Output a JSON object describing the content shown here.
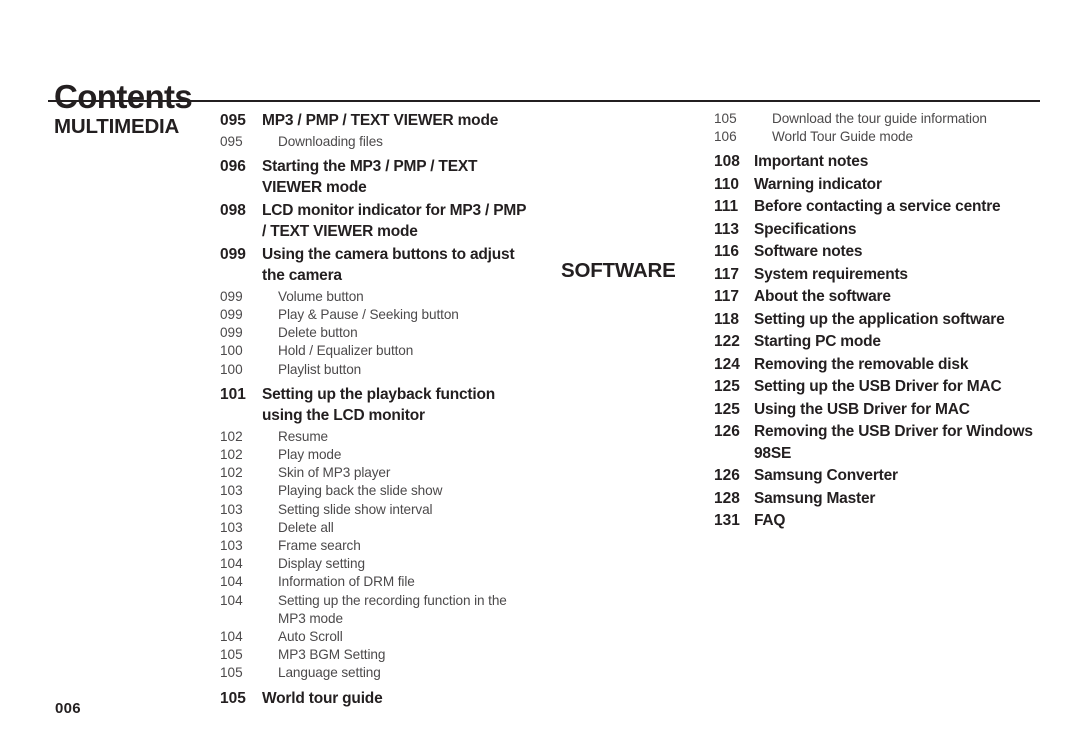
{
  "header": {
    "title": "Contents"
  },
  "footer": {
    "folio": "006"
  },
  "sections": {
    "multimedia_label": "MULTIMEDIA",
    "software_label": "SOFTWARE"
  },
  "columns": {
    "left": [
      {
        "num": "095",
        "title": "MP3 / PMP / TEXT VIEWER mode",
        "level": "major"
      },
      {
        "num": "095",
        "title": "Downloading files",
        "level": "minor"
      },
      {
        "num": "096",
        "title": "Starting the MP3 / PMP / TEXT VIEWER mode",
        "level": "major"
      },
      {
        "num": "098",
        "title": "LCD monitor indicator for MP3 / PMP / TEXT VIEWER mode",
        "level": "major"
      },
      {
        "num": "099",
        "title": "Using the camera buttons to adjust the camera",
        "level": "major"
      },
      {
        "num": "099",
        "title": "Volume button",
        "level": "minor"
      },
      {
        "num": "099",
        "title": "Play & Pause / Seeking button",
        "level": "minor"
      },
      {
        "num": "099",
        "title": "Delete button",
        "level": "minor"
      },
      {
        "num": "100",
        "title": "Hold / Equalizer button",
        "level": "minor"
      },
      {
        "num": "100",
        "title": "Playlist button",
        "level": "minor"
      },
      {
        "num": "101",
        "title": "Setting up the playback function using the LCD monitor",
        "level": "major"
      },
      {
        "num": "102",
        "title": "Resume",
        "level": "minor"
      },
      {
        "num": "102",
        "title": "Play mode",
        "level": "minor"
      },
      {
        "num": "102",
        "title": "Skin of MP3 player",
        "level": "minor"
      },
      {
        "num": "103",
        "title": "Playing back the slide show",
        "level": "minor"
      },
      {
        "num": "103",
        "title": "Setting slide show interval",
        "level": "minor"
      },
      {
        "num": "103",
        "title": "Delete all",
        "level": "minor"
      },
      {
        "num": "103",
        "title": "Frame search",
        "level": "minor"
      },
      {
        "num": "104",
        "title": "Display setting",
        "level": "minor"
      },
      {
        "num": "104",
        "title": "Information of DRM file",
        "level": "minor"
      },
      {
        "num": "104",
        "title": "Setting up the recording function in the MP3 mode",
        "level": "minor"
      },
      {
        "num": "104",
        "title": "Auto Scroll",
        "level": "minor"
      },
      {
        "num": "105",
        "title": "MP3 BGM Setting",
        "level": "minor"
      },
      {
        "num": "105",
        "title": "Language setting",
        "level": "minor"
      },
      {
        "num": "105",
        "title": "World tour guide",
        "level": "major"
      }
    ],
    "right": [
      {
        "num": "105",
        "title": "Download the tour guide information",
        "level": "minor"
      },
      {
        "num": "106",
        "title": "World Tour Guide mode",
        "level": "minor"
      },
      {
        "num": "108",
        "title": "Important notes",
        "level": "major"
      },
      {
        "num": "110",
        "title": "Warning indicator",
        "level": "major"
      },
      {
        "num": "111",
        "title": "Before contacting a service centre",
        "level": "major"
      },
      {
        "num": "113",
        "title": "Specifications",
        "level": "major"
      },
      {
        "num": "116",
        "title": "Software notes",
        "level": "major"
      },
      {
        "num": "117",
        "title": "System requirements",
        "level": "major"
      },
      {
        "num": "117",
        "title": "About the software",
        "level": "major"
      },
      {
        "num": "118",
        "title": "Setting up the application software",
        "level": "major"
      },
      {
        "num": "122",
        "title": "Starting PC mode",
        "level": "major"
      },
      {
        "num": "124",
        "title": "Removing the removable disk",
        "level": "major"
      },
      {
        "num": "125",
        "title": "Setting up the USB Driver for MAC",
        "level": "major"
      },
      {
        "num": "125",
        "title": "Using the USB Driver for MAC",
        "level": "major"
      },
      {
        "num": "126",
        "title": "Removing the USB Driver for Windows 98SE",
        "level": "major"
      },
      {
        "num": "126",
        "title": "Samsung Converter",
        "level": "major"
      },
      {
        "num": "128",
        "title": "Samsung Master",
        "level": "major"
      },
      {
        "num": "131",
        "title": "FAQ",
        "level": "major"
      }
    ]
  }
}
